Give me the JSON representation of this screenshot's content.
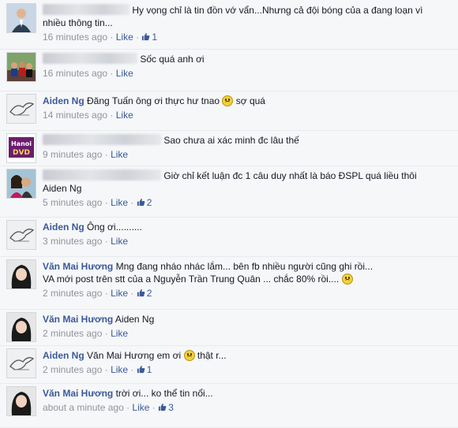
{
  "comments": [
    {
      "author": "",
      "redacted": true,
      "text": "Hy vọng chỉ là tin đồn vớ vẩn...Nhưng cả đội bóng của a đang loạn vì",
      "text2": "nhiều thông tin...",
      "time": "16 minutes ago",
      "like_label": "Like",
      "likes": "1",
      "avatar": "man-in-suit"
    },
    {
      "author": "",
      "redacted": true,
      "text": "Sốc quá anh ơi",
      "text2": "",
      "time": "16 minutes ago",
      "like_label": "Like",
      "likes": "",
      "avatar": "group-photo"
    },
    {
      "author": "Aiden Ng",
      "redacted": false,
      "text": "Đăng Tuấn ông ơi thực hư tnao",
      "emoticon_before": "sad",
      "text_after": "sợ quá",
      "text2": "",
      "time": "14 minutes ago",
      "like_label": "Like",
      "likes": "",
      "avatar": "bird-sketch"
    },
    {
      "author": "",
      "redacted": true,
      "text": "Sao chưa ai xác minh đc lâu thế",
      "text2": "",
      "time": "9 minutes ago",
      "like_label": "Like",
      "likes": "",
      "avatar": "hanoi-dvd"
    },
    {
      "author": "",
      "redacted": true,
      "text": "Giờ chỉ kết luận đc 1 câu duy nhất là báo ĐSPL quá liều thôi",
      "text2": "Aiden Ng",
      "time": "5 minutes ago",
      "like_label": "Like",
      "likes": "2",
      "avatar": "couple-photo"
    },
    {
      "author": "Aiden Ng",
      "redacted": false,
      "text": "Ông ơi..........",
      "text2": "",
      "time": "3 minutes ago",
      "like_label": "Like",
      "likes": "",
      "avatar": "bird-sketch"
    },
    {
      "author": "Văn Mai Hương",
      "redacted": false,
      "text": "Mng đang nháo nhác lắm... bên fb nhiều người cũng ghi rồi...",
      "text2": "VA mới post trên stt của a Nguyễn Trần Trung Quân ... chắc 80% rồi....",
      "emoticon_end": "sad",
      "time": "2 minutes ago",
      "like_label": "Like",
      "likes": "2",
      "avatar": "woman-portrait"
    },
    {
      "author": "Văn Mai Hương",
      "redacted": false,
      "text": "Aiden Ng",
      "text2": "",
      "time": "2 minutes ago",
      "like_label": "Like",
      "likes": "",
      "avatar": "woman-portrait"
    },
    {
      "author": "Aiden Ng",
      "redacted": false,
      "text": "Văn Mai Hương em ơi",
      "emoticon_before": "sad",
      "text_after": "thật r...",
      "text2": "",
      "time": "2 minutes ago",
      "like_label": "Like",
      "likes": "1",
      "avatar": "bird-sketch"
    },
    {
      "author": "Văn Mai Hương",
      "redacted": false,
      "text": "trời ơi... ko thể tin nổi...",
      "text2": "",
      "time": "about a minute ago",
      "like_label": "Like",
      "likes": "3",
      "avatar": "woman-portrait"
    }
  ],
  "colors": {
    "link": "#3b5998",
    "meta": "#90949c",
    "text": "#141823",
    "background": "#f6f7f9"
  },
  "icons": {
    "like": "thumbs-up-icon",
    "emoticon": "sad-face-icon"
  }
}
